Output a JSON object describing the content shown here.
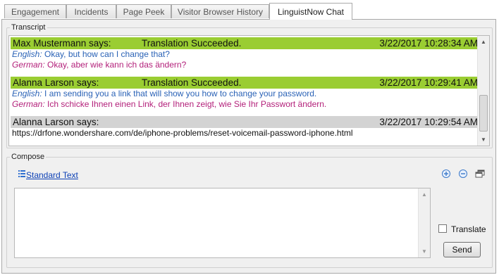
{
  "tabs": [
    {
      "label": "Engagement",
      "active": false
    },
    {
      "label": "Incidents",
      "active": false
    },
    {
      "label": "Page Peek",
      "active": false
    },
    {
      "label": "Visitor Browser History",
      "active": false
    },
    {
      "label": "LinguistNow Chat",
      "active": true
    }
  ],
  "transcript": {
    "legend": "Transcript",
    "messages": [
      {
        "sender": "Max Mustermann says:",
        "status": "Translation Succeeded.",
        "timestamp": "3/22/2017 10:28:34 AM",
        "highlight": "#9acd32",
        "english_label": "English:",
        "english_text": " Okay, but how can I change that?",
        "german_label": "German:",
        "german_text": " Okay, aber wie kann ich das ändern?"
      },
      {
        "sender": "Alanna Larson says:",
        "status": "Translation Succeeded.",
        "timestamp": "3/22/2017 10:29:41 AM",
        "highlight": "#9acd32",
        "english_label": "English:",
        "english_text": " I am sending you a link that will show you how to change your password.",
        "german_label": "German:",
        "german_text": " Ich schicke Ihnen einen Link, der Ihnen zeigt, wie Sie Ihr Passwort ändern."
      },
      {
        "sender": "Alanna Larson says:",
        "timestamp": "3/22/2017 10:29:54 AM",
        "highlight": "#d3d3d3",
        "text": "https://drfone.wondershare.com/de/iphone-problems/reset-voicemail-password-iphone.html"
      }
    ]
  },
  "compose": {
    "legend": "Compose",
    "standard_text_link": "Standard Text",
    "message_value": "",
    "translate_label": "Translate",
    "translate_checked": false,
    "send_label": "Send"
  },
  "icons": {
    "standard_text": "list-icon",
    "zoom_in": "zoom-in-icon",
    "zoom_out": "zoom-out-icon",
    "popout": "window-popout-icon"
  },
  "colors": {
    "translated_header": "#9acd32",
    "plain_header": "#d3d3d3",
    "english_text": "#2a62b6",
    "german_text": "#b3207a",
    "link": "#0b3fb5"
  }
}
